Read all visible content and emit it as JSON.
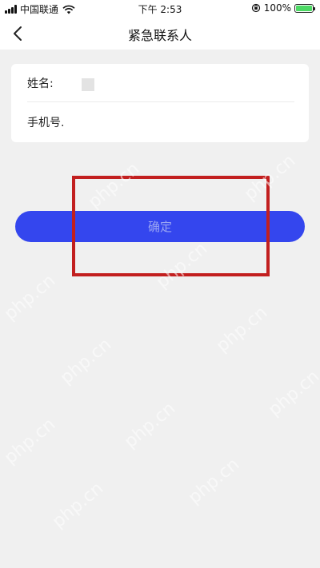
{
  "status_bar": {
    "carrier": "中国联通",
    "time": "下午 2:53",
    "battery": "100%",
    "battery_level": 1.0
  },
  "nav": {
    "back_icon": "chevron-left-icon",
    "title": "紧急联系人"
  },
  "form": {
    "name_label": "姓名:",
    "name_value": "",
    "phone_label": "手机号.",
    "phone_value": ""
  },
  "confirm_label": "确定",
  "watermark_text": "php.cn",
  "colors": {
    "primary": "#3446ee",
    "button_text": "#9aa5f3",
    "highlight": "#c21f1f",
    "background": "#f0f0f0"
  }
}
